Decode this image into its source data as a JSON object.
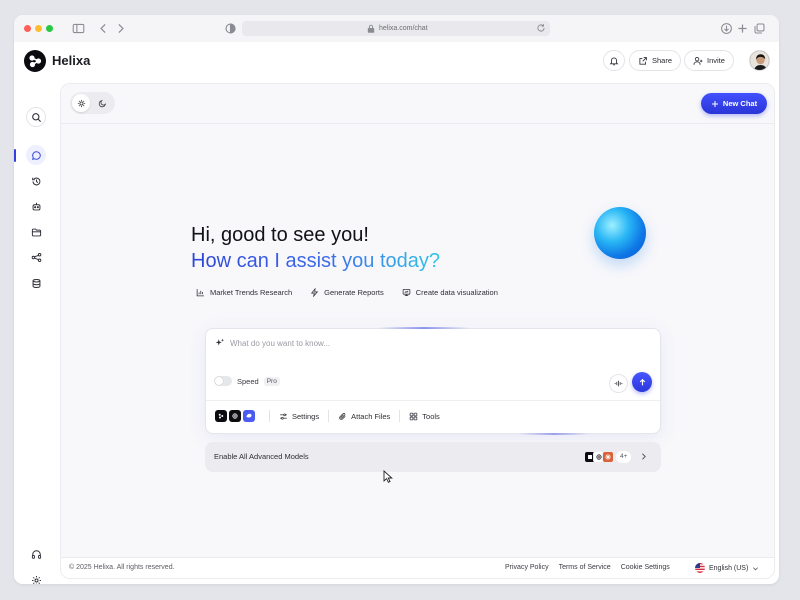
{
  "browser": {
    "url": "helixa.com/chat"
  },
  "app": {
    "name": "Helixa"
  },
  "header": {
    "share_label": "Share",
    "invite_label": "Invite"
  },
  "toolbar": {
    "new_chat_label": "New Chat",
    "theme_options": [
      "sun-icon",
      "moon-icon"
    ],
    "active_theme": "light"
  },
  "sidebar": {
    "items": [
      {
        "name": "search",
        "icon": "search-icon"
      },
      {
        "name": "chat",
        "icon": "chat-bubble-icon",
        "active": true
      },
      {
        "name": "history",
        "icon": "history-icon"
      },
      {
        "name": "bots",
        "icon": "robot-icon"
      },
      {
        "name": "files",
        "icon": "folder-icon"
      },
      {
        "name": "share",
        "icon": "share-nodes-icon"
      },
      {
        "name": "database",
        "icon": "database-icon"
      }
    ],
    "bottom": [
      {
        "name": "support",
        "icon": "headphones-icon"
      },
      {
        "name": "settings",
        "icon": "gear-icon"
      }
    ]
  },
  "greeting": {
    "line1": "Hi, good to see you!",
    "line2": "How can I assist you today?"
  },
  "suggestions": [
    {
      "label": "Market Trends Research",
      "icon": "bar-chart-icon"
    },
    {
      "label": "Generate Reports",
      "icon": "lightning-icon"
    },
    {
      "label": "Create data visualization",
      "icon": "monitor-icon"
    }
  ],
  "prompt": {
    "placeholder": "What do you want to know...",
    "value": "",
    "speed_label": "Speed",
    "speed_enabled": false,
    "pro_badge": "Pro",
    "tools": [
      {
        "label": "Settings",
        "icon": "sliders-icon"
      },
      {
        "label": "Attach Files",
        "icon": "paperclip-icon"
      },
      {
        "label": "Tools",
        "icon": "grid-icon"
      }
    ]
  },
  "models_bar": {
    "label": "Enable All Advanced Models",
    "more_count": "4+"
  },
  "footer": {
    "copyright": "© 2025 Helixa. All rights reserved.",
    "links": [
      "Privacy Policy",
      "Terms of Service",
      "Cookie Settings"
    ],
    "language": "English (US)"
  },
  "colors": {
    "accent": "#3340e0",
    "orb": "#1a8cf0"
  }
}
